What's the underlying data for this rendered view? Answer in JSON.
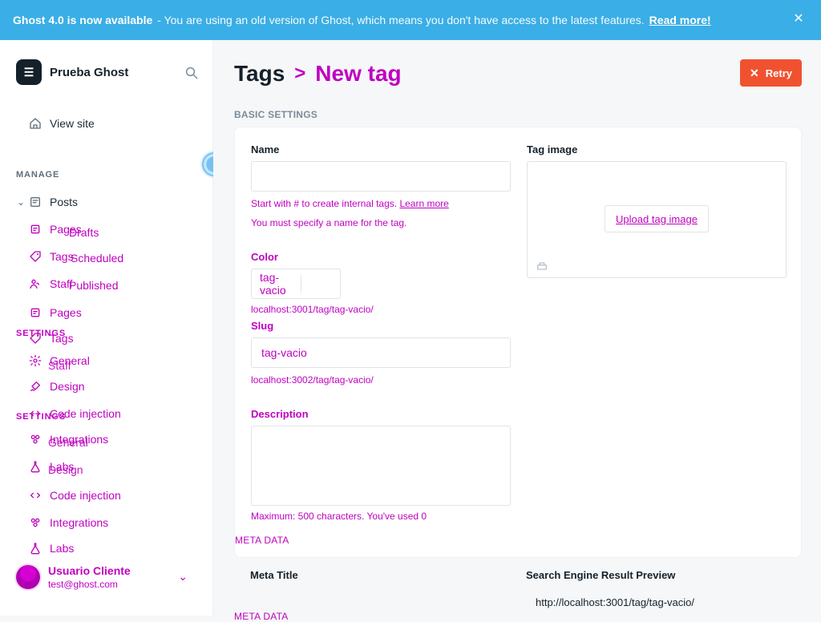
{
  "banner": {
    "title": "Ghost 4.0 is now available",
    "text": "- You are using an old version of Ghost, which means you don't have access to the latest features.",
    "link": "Read more!",
    "close_glyph": "✕",
    "colors": {
      "background": "#3aaee6",
      "text": "#ffffff"
    }
  },
  "sidebar": {
    "brand": {
      "badge": "☰",
      "name": "Prueba Ghost"
    },
    "search_icon": "search-icon",
    "view_site": "View site",
    "sections": {
      "manage": "MANAGE",
      "settings_1": "SETTINGS",
      "settings_2": "SETTINGS"
    },
    "nav": {
      "posts": "Posts",
      "pages": "Pages",
      "tags": "Tags",
      "staff": "Staff",
      "general": "General",
      "design": "Design",
      "code_injection": "Code injection",
      "integrations": "Integrations",
      "labs": "Labs"
    },
    "posts_sub": {
      "drafts": "Drafts",
      "scheduled": "Scheduled",
      "published": "Published"
    },
    "user": {
      "name": "Usuario Cliente",
      "email": "test@ghost.com"
    }
  },
  "main": {
    "breadcrumb": {
      "tags": "Tags",
      "sep": ">",
      "current": "New tag"
    },
    "retry_label": "Retry",
    "basic_settings": "BASIC SETTINGS",
    "name_label": "Name",
    "tag_image_label": "Tag image",
    "name_hint_1": "Start with # to create internal tags.",
    "name_hint_2": "Learn more",
    "name_hint_3": "You must specify a name for the tag.",
    "color_label": "Color",
    "color_value": "tag-vacio",
    "url_1": "localhost:3001/tag/tag-vacio/",
    "slug_label": "Slug",
    "slug_value": "tag-vacio",
    "url_2": "localhost:3002/tag/tag-vacio/",
    "description_label": "Description",
    "description_hint": "Maximum: 500 characters. You've used 0",
    "upload_label": "Upload tag image",
    "meta_data": "META DATA",
    "meta_title_label": "Meta Title",
    "serp_label": "Search Engine Result Preview",
    "serp_url": "http://localhost:3001/tag/tag-vacio/",
    "colors": {
      "accent": "#c000c0",
      "danger": "#f05230"
    }
  }
}
